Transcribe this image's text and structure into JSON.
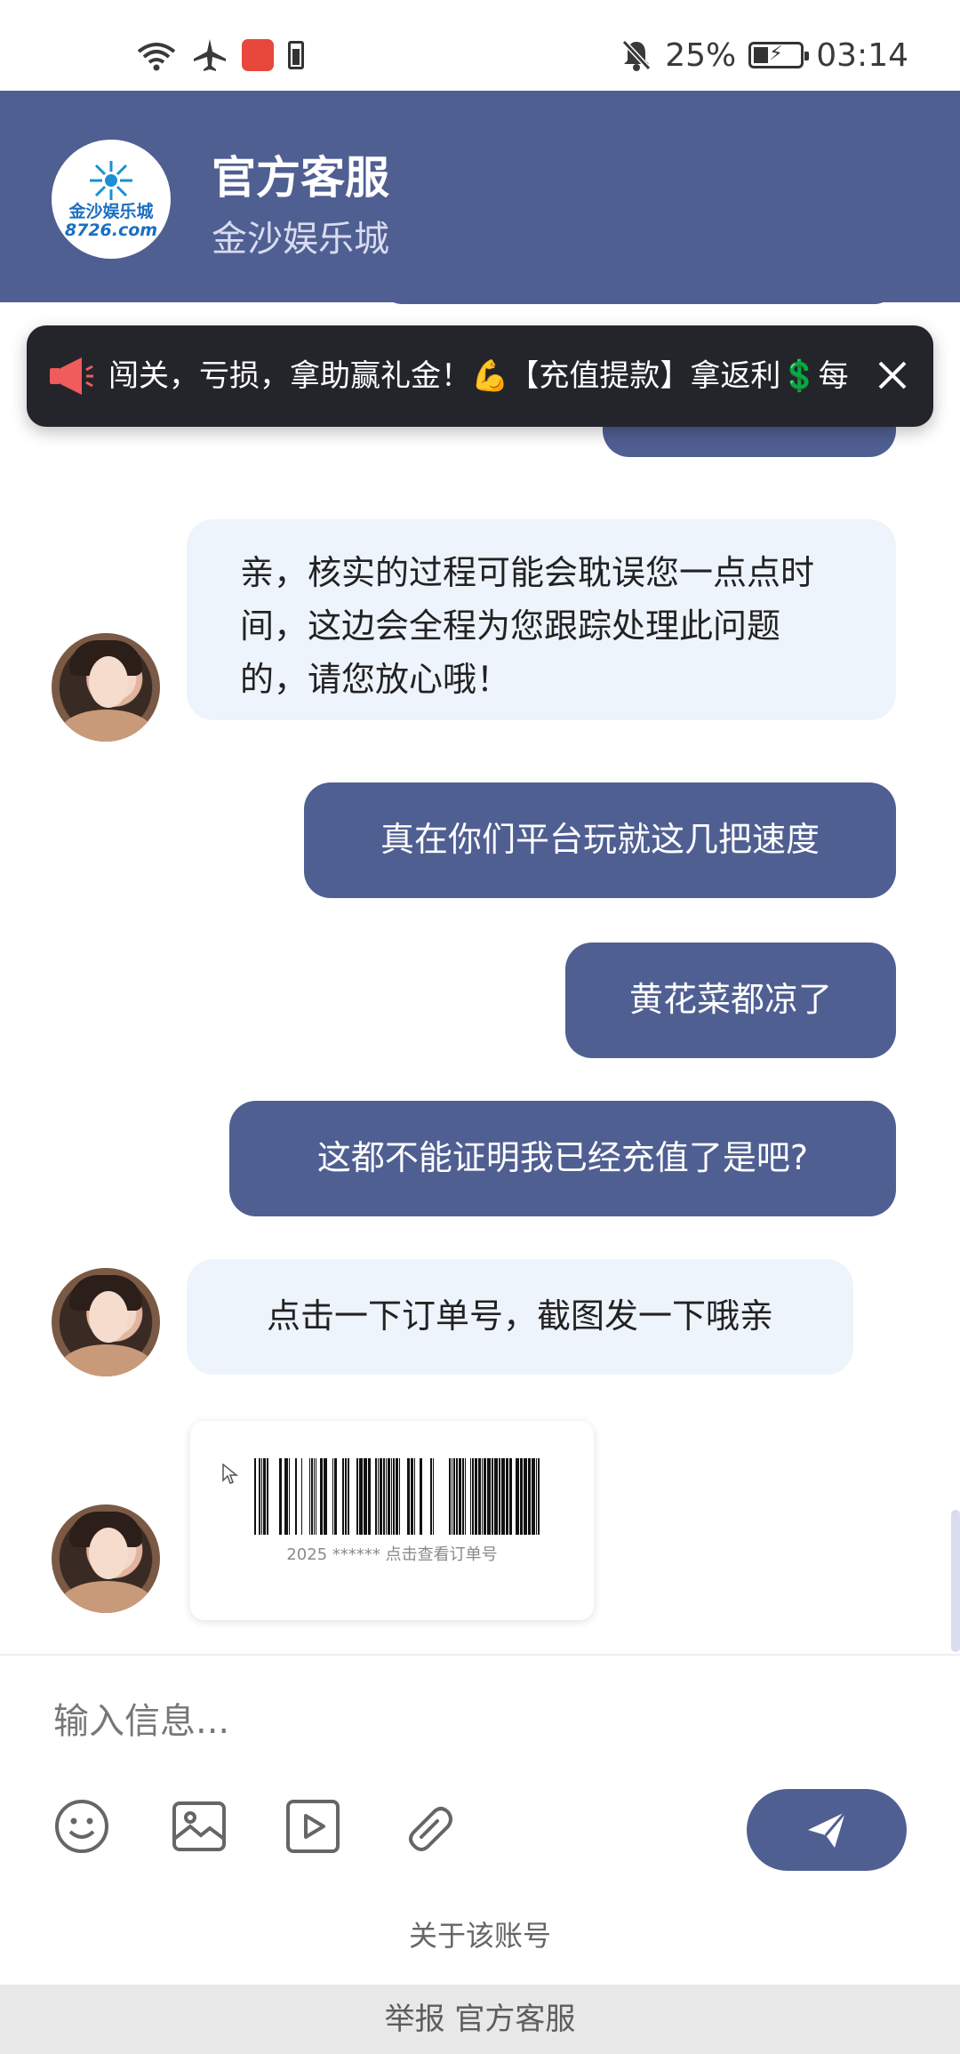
{
  "status_bar": {
    "battery_percent": "25%",
    "time": "03:14",
    "icons": [
      "wifi-icon",
      "airplane-icon",
      "huawei-app-icon",
      "battery-small-icon",
      "mute-bell-icon",
      "charging-battery-icon"
    ]
  },
  "header": {
    "title": "官方客服",
    "subtitle": "金沙娱乐城",
    "logo_text": "金沙娱乐城",
    "logo_url": "8726.com"
  },
  "notice": {
    "text": "闯关，亏损，拿助赢礼金！💪【充值提款】拿返利💲每"
  },
  "messages": [
    {
      "side": "out",
      "text": "",
      "partial": true
    },
    {
      "side": "out",
      "text": "",
      "partial": true
    },
    {
      "side": "in",
      "text": "亲，核实的过程可能会耽误您一点点时间，这边会全程为您跟踪处理此问题的，请您放心哦！"
    },
    {
      "side": "out",
      "text": "真在你们平台玩就这几把速度"
    },
    {
      "side": "out",
      "text": "黄花菜都凉了"
    },
    {
      "side": "out",
      "text": "这都不能证明我已经充值了是吧?"
    },
    {
      "side": "in",
      "text": "点击一下订单号，截图发一下哦亲"
    }
  ],
  "order_card": {
    "caption": "2025 ****** 点击查看订单号"
  },
  "input": {
    "placeholder": "输入信息..."
  },
  "toolbar": {
    "tools": [
      "emoji-icon",
      "image-icon",
      "video-icon",
      "attachment-icon"
    ],
    "send_icon": "send-icon"
  },
  "footer": {
    "about": "关于该账号",
    "report": "举报 官方客服"
  },
  "colors": {
    "header_bg": "#505f92",
    "outgoing_bubble": "#505f92",
    "incoming_bubble": "#eef4fc",
    "notice_bg": "#23252b"
  }
}
